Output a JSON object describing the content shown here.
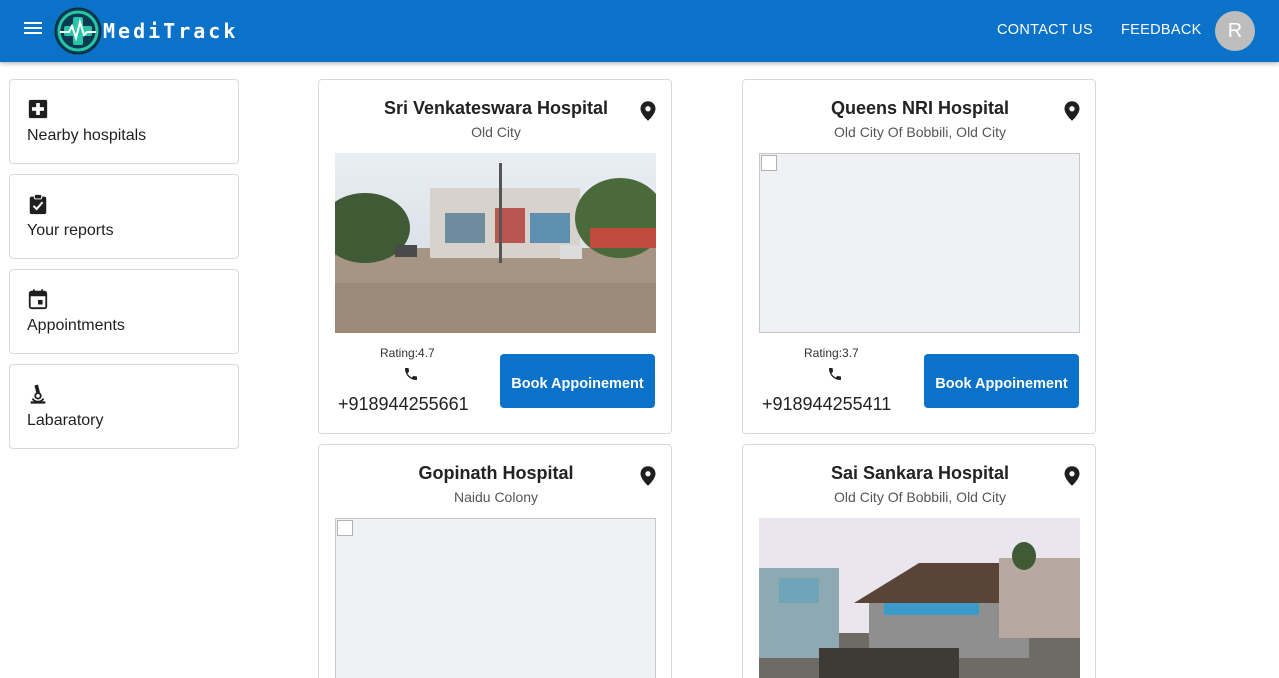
{
  "header": {
    "brand": "MediTrack",
    "links": [
      "CONTACT US",
      "FEEDBACK"
    ],
    "avatar_initial": "R",
    "bg_color": "#0a72c9"
  },
  "sidebar": {
    "items": [
      {
        "label": "Nearby hospitals",
        "icon": "medical-plus-icon"
      },
      {
        "label": "Your reports",
        "icon": "clipboard-check-icon"
      },
      {
        "label": "Appointments",
        "icon": "calendar-event-icon"
      },
      {
        "label": "Labaratory",
        "icon": "microscope-icon"
      }
    ]
  },
  "hospitals": [
    {
      "name": "Sri Venkateswara Hospital",
      "location": "Old City",
      "rating_text": "Rating:4.7",
      "phone": "+918944255661",
      "button": "Book Appoinement",
      "photo": "street-photo"
    },
    {
      "name": "Queens NRI Hospital",
      "location": "Old City Of Bobbili, Old City",
      "rating_text": "Rating:3.7",
      "phone": "+918944255411",
      "button": "Book Appoinement",
      "photo": "broken-image"
    },
    {
      "name": "Gopinath Hospital",
      "location": "Naidu Colony",
      "photo": "broken-image"
    },
    {
      "name": "Sai Sankara Hospital",
      "location": "Old City Of Bobbili, Old City",
      "photo": "street-photo"
    }
  ]
}
